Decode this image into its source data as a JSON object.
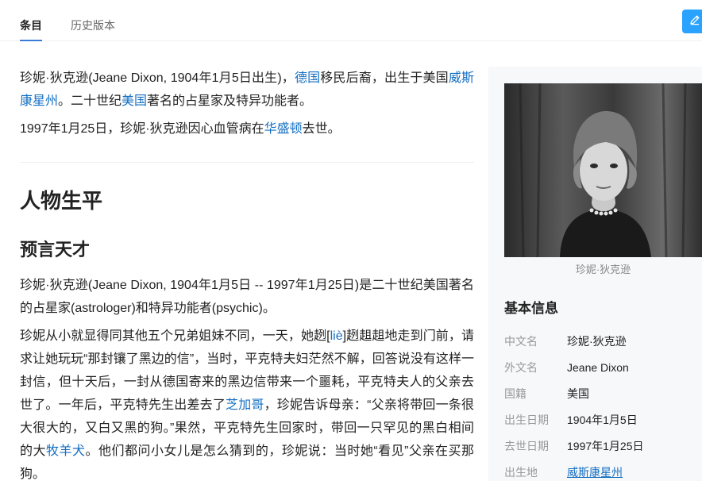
{
  "tabs": {
    "entry": "条目",
    "history": "历史版本"
  },
  "intro": {
    "p1_a": "珍妮·狄克逊(Jeane Dixon, 1904年1月5日出生)，",
    "p1_link1": "德国",
    "p1_b": "移民后裔，出生于美国",
    "p1_link2": "威斯康星州",
    "p1_c": "。二十世纪",
    "p1_link3": "美国",
    "p1_d": "著名的占星家及特异功能者。",
    "p2_a": "1997年1月25日，珍妮·狄克逊因心血管病在",
    "p2_link": "华盛顿",
    "p2_b": "去世。"
  },
  "section": {
    "h2": "人物生平",
    "h3": "预言天才"
  },
  "body": {
    "p1": "珍妮·狄克逊(Jeane Dixon, 1904年1月5日 -- 1997年1月25日)是二十世纪美国著名的占星家(astrologer)和特异功能者(psychic)。",
    "p2_a": "珍妮从小就显得同其他五个兄弟姐妹不同，一天，她趔[",
    "p2_pinyin": "liè",
    "p2_b": "]趔趄趄地走到门前，请求让她玩玩“那封镶了黑边的信”，当时，平克特夫妇茫然不解，回答说没有这样一封信，但十天后，一封从德国寄来的黑边信带来一个噩耗，平克特夫人的父亲去世了。一年后，平克特先生出差去了",
    "p2_link1": "芝加哥",
    "p2_c": "，珍妮告诉母亲：“父亲将带回一条很大很大的，又白又黑的狗。”果然，平克特先生回家时，带回一只罕见的黑白相间的大",
    "p2_link2": "牧羊犬",
    "p2_d": "。他们都问小女儿是怎么猜到的，珍妮说：当时她“看见”父亲在买那狗。"
  },
  "sidebar": {
    "caption": "珍妮·狄克逊",
    "info_title": "基本信息",
    "rows": [
      {
        "key": "中文名",
        "value": "珍妮·狄克逊"
      },
      {
        "key": "外文名",
        "value": "Jeane Dixon"
      },
      {
        "key": "国籍",
        "value": "美国"
      },
      {
        "key": "出生日期",
        "value": "1904年1月5日"
      },
      {
        "key": "去世日期",
        "value": "1997年1月25日"
      },
      {
        "key": "出生地",
        "value": "威斯康星州"
      }
    ]
  },
  "icons": {
    "edit": "pencil-icon"
  },
  "colors": {
    "link": "#136ec2",
    "edit_button": "#2aa2ff",
    "active_tab_underline": "#3a7bd5"
  }
}
